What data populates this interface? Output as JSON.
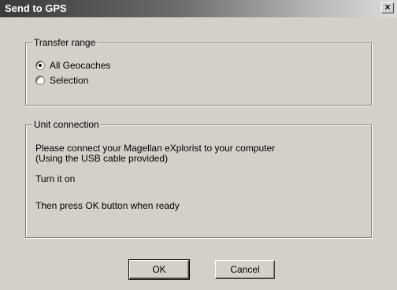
{
  "window": {
    "title": "Send to GPS",
    "close_glyph": "×"
  },
  "transfer_range": {
    "legend": "Transfer range",
    "options": [
      {
        "label": "All Geocaches",
        "selected": true
      },
      {
        "label": "Selection",
        "selected": false
      }
    ]
  },
  "unit_connection": {
    "legend": "Unit connection",
    "lines": [
      "Please connect your Magellan eXplorist to your computer",
      "(Using the USB cable provided)",
      "Turn it on",
      "Then press OK button when ready"
    ]
  },
  "buttons": {
    "ok": "OK",
    "cancel": "Cancel"
  }
}
